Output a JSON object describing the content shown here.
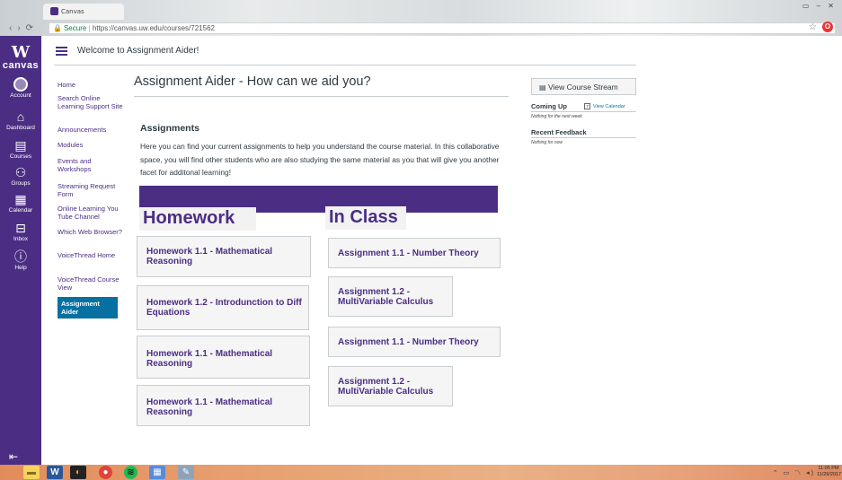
{
  "browser": {
    "tab_title": "Canvas",
    "secure_label": "Secure",
    "url": "https://canvas.uw.edu/courses/721562"
  },
  "global_nav": {
    "logo_letter": "W",
    "logo_text": "canvas",
    "items": [
      {
        "label": "Account",
        "icon": "account-icon"
      },
      {
        "label": "Dashboard",
        "icon": "dashboard-icon"
      },
      {
        "label": "Courses",
        "icon": "courses-icon"
      },
      {
        "label": "Groups",
        "icon": "groups-icon"
      },
      {
        "label": "Calendar",
        "icon": "calendar-icon"
      },
      {
        "label": "Inbox",
        "icon": "inbox-icon"
      },
      {
        "label": "Help",
        "icon": "help-icon"
      }
    ]
  },
  "header": {
    "breadcrumb": "Welcome to Assignment Aider!"
  },
  "course_nav": {
    "items": [
      "Home",
      "Search Online Learning Support Site",
      "Announcements",
      "Modules",
      "Events and Workshops",
      "Streaming Request Form",
      "Online Learning You Tube Channel",
      "Which Web Browser?",
      "VoiceThread Home",
      "VoiceThread Course View",
      "Assignment Aider"
    ],
    "active": "Assignment Aider"
  },
  "main": {
    "title": "Assignment Aider - How can we aid you?",
    "assignments_heading": "Assignments",
    "description": "Here you can find your current assignments to help you understand the course material. In this collaborative space, you will find other students who are also studying the same material as you that will give you another facet for additonal learning!",
    "homework_heading": "Homework",
    "inclass_heading": "In Class",
    "homework_cards": [
      "Homework 1.1 - Mathematical Reasoning",
      "Homework 1.2 - Introdunction to Diff Equations",
      "Homework 1.1 - Mathematical Reasoning",
      "Homework 1.1 - Mathematical Reasoning"
    ],
    "inclass_cards": [
      "Assignment 1.1 - Number Theory",
      "Assignment 1.2 - MultiVariable Calculus",
      "Assignment 1.1 - Number Theory",
      "Assignment 1.2 - MultiVariable Calculus"
    ]
  },
  "sidebar": {
    "stream_button": "View Course Stream",
    "coming_up": "Coming Up",
    "view_calendar": "View Calendar",
    "coming_up_empty": "Nothing for the next week",
    "recent_feedback": "Recent Feedback",
    "recent_feedback_empty": "Nothing for now"
  },
  "taskbar": {
    "clock_time": "11:05 PM",
    "clock_date": "11/29/2017"
  },
  "colors": {
    "brand_purple": "#4b2e83",
    "link_blue": "#0770a3",
    "text": "#2d3b45"
  }
}
